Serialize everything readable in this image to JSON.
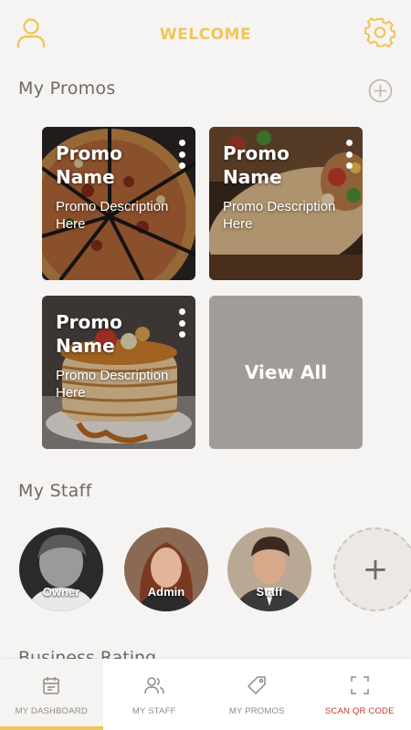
{
  "header": {
    "title": "WELCOME",
    "accent_color": "#f2c55a",
    "left_icon": "user-icon",
    "right_icon": "gear-icon"
  },
  "promos": {
    "title": "My Promos",
    "add_icon": "plus-circle-icon",
    "cards": [
      {
        "name": "Promo Name",
        "description": "Promo Description Here",
        "image": "pizza"
      },
      {
        "name": "Promo Name",
        "description": "Promo Description Here",
        "image": "burrito"
      },
      {
        "name": "Promo Name",
        "description": "Promo Description Here",
        "image": "pancakes"
      }
    ],
    "view_all_label": "View All"
  },
  "staff": {
    "title": "My Staff",
    "members": [
      {
        "role": "Owner"
      },
      {
        "role": "Admin"
      },
      {
        "role": "Staff"
      }
    ],
    "add_label": "+"
  },
  "business_rating": {
    "title": "Business Rating"
  },
  "bottom_nav": {
    "items": [
      {
        "label": "MY DASHBOARD",
        "icon": "calendar-icon",
        "active": true
      },
      {
        "label": "MY STAFF",
        "icon": "users-icon",
        "active": false
      },
      {
        "label": "MY  PROMOS",
        "icon": "tag-icon",
        "active": false
      },
      {
        "label": "SCAN QR CODE",
        "icon": "scan-frame-icon",
        "active": false
      }
    ]
  }
}
